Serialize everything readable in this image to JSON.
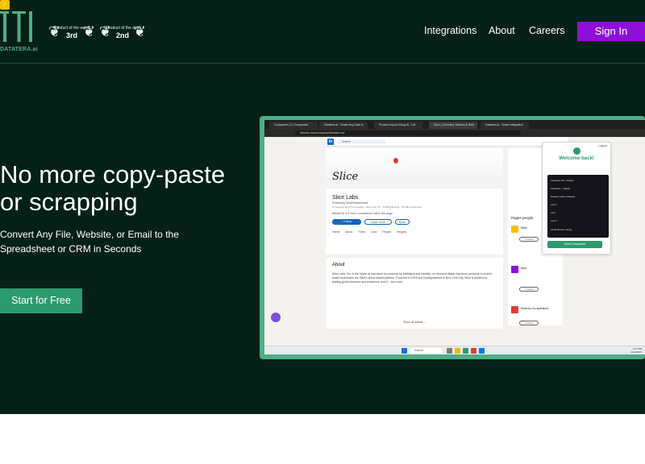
{
  "brand": {
    "name": "DATATERA.ai",
    "accent": "#4fae86",
    "bg": "#052017",
    "signin_color": "#8e10d8"
  },
  "awards": [
    {
      "title": "Product of the week",
      "rank": "3rd"
    },
    {
      "title": "Product of the day",
      "rank": "2nd"
    }
  ],
  "nav": {
    "integrations": "Integrations",
    "about": "About",
    "careers": "Careers",
    "signin": "Sign In"
  },
  "hero": {
    "headline": "No more copy-paste or scrapping",
    "subhead": "Convert Any File, Website, or Email to the Spreadsheet or CRM in Seconds",
    "cta": "Start for Free"
  },
  "mockup": {
    "tabs": [
      "Companies | LI Companies",
      "Datatera.ai - Smart Any Data to",
      "Product Import Using AI - Uni",
      "Slice | Overview, Mission & Web",
      "Datatera.ai - Smart Integration"
    ],
    "url": "linkedin.com/company/slicelabs-inc/",
    "search": "Search",
    "company": {
      "logo_word": "Slice",
      "name": "Slice Labs",
      "tagline": "Protecting Small Businesses",
      "meta": "IT Services and IT Consulting · New York, NY · 6,500 followers · 51-200 employees",
      "connections": "Nikolai Oj & 3 other connections follow this page",
      "follow": "+ Follow",
      "learn_more": "Learn more",
      "more": "More",
      "tabs": "Home About Posts Jobs People Insights"
    },
    "about": {
      "heading": "About",
      "text": "Slice Labs, Inc. is the future of insurance by powered by intelligent and intuitive, on-demand digital insurance products to protect small businesses are Slice's cloud-based platform. Founded in 2015 and headquartered in New York City, Slice is backed by leading global insurers and reinsurers, and it... see more",
      "show_all": "Show all details →"
    },
    "pages_people": {
      "heading": "Pages people",
      "items": [
        {
          "name": "Slice",
          "color": "#f5c400",
          "follow": "+ Follow"
        },
        {
          "name": "slice",
          "color": "#8e10d8",
          "follow": "+ Follow"
        },
        {
          "name": "Dusa by Co-operators",
          "color": "#e23a3a",
          "follow": "+ Follow"
        }
      ]
    },
    "extension": {
      "logout": "Logout",
      "welcome": "Welcome back!",
      "items": [
        "Investors list + Digest",
        "Investors + Digest",
        "Nearby Calls to Digest",
        "Last 7",
        "Last",
        "Last 1",
        "LE Business Listing"
      ],
      "button": "Save Companies"
    },
    "taskbar": {
      "search": "Search",
      "time": "1:37 PM",
      "date": "4/12/2023"
    }
  }
}
